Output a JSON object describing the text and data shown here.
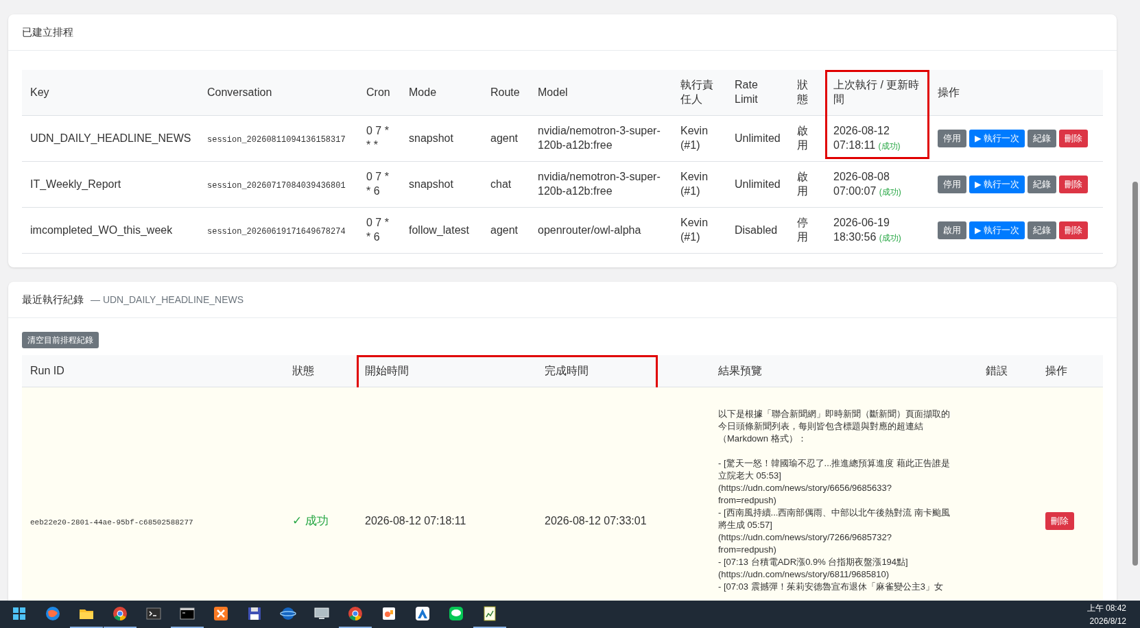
{
  "schedules": {
    "title": "已建立排程",
    "columns": [
      {
        "label": "Key",
        "highlighted": false
      },
      {
        "label": "Conversation",
        "highlighted": false
      },
      {
        "label": "Cron",
        "highlighted": false
      },
      {
        "label": "Mode",
        "highlighted": false
      },
      {
        "label": "Route",
        "highlighted": false
      },
      {
        "label": "Model",
        "highlighted": false
      },
      {
        "label": "執行責任人",
        "highlighted": false
      },
      {
        "label": "Rate Limit",
        "highlighted": false
      },
      {
        "label": "狀態",
        "highlighted": false
      },
      {
        "label": "上次執行 / 更新時間",
        "highlighted": true
      },
      {
        "label": "操作",
        "highlighted": false
      }
    ],
    "rows": [
      {
        "key": "UDN_DAILY_HEADLINE_NEWS",
        "conversation": "session_20260811094136158317",
        "cron": "0 7 * * *",
        "mode": "snapshot",
        "route": "agent",
        "model": "nvidia/nemotron-3-super-120b-a12b:free",
        "owner": "Kevin (#1)",
        "rate_limit": "Unlimited",
        "status": "啟用",
        "last_run_time": "2026-08-12 07:18:11",
        "last_run_result": {
          "label": "(成功)",
          "kind": "success"
        },
        "actions": [
          {
            "label": "停用",
            "kind": "secondary"
          },
          {
            "label": "▶ 執行一次",
            "kind": "primary"
          },
          {
            "label": "紀錄",
            "kind": "secondary"
          },
          {
            "label": "刪除",
            "kind": "danger"
          }
        ]
      },
      {
        "key": "IT_Weekly_Report",
        "conversation": "session_20260717084039436801",
        "cron": "0 7 * * 6",
        "mode": "snapshot",
        "route": "chat",
        "model": "nvidia/nemotron-3-super-120b-a12b:free",
        "owner": "Kevin (#1)",
        "rate_limit": "Unlimited",
        "status": "啟用",
        "last_run_time": "2026-08-08 07:00:07",
        "last_run_result": {
          "label": "(成功)",
          "kind": "success"
        },
        "actions": [
          {
            "label": "停用",
            "kind": "secondary"
          },
          {
            "label": "▶ 執行一次",
            "kind": "primary"
          },
          {
            "label": "紀錄",
            "kind": "secondary"
          },
          {
            "label": "刪除",
            "kind": "danger"
          }
        ]
      },
      {
        "key": "imcompleted_WO_this_week",
        "conversation": "session_20260619171649678274",
        "cron": "0 7 * * 6",
        "mode": "follow_latest",
        "route": "agent",
        "model": "openrouter/owl-alpha",
        "owner": "Kevin (#1)",
        "rate_limit": "Disabled",
        "status": "停用",
        "last_run_time": "2026-06-19 18:30:56",
        "last_run_result": {
          "label": "(成功)",
          "kind": "success"
        },
        "actions": [
          {
            "label": "啟用",
            "kind": "secondary"
          },
          {
            "label": "▶ 執行一次",
            "kind": "primary"
          },
          {
            "label": "紀錄",
            "kind": "secondary"
          },
          {
            "label": "刪除",
            "kind": "danger"
          }
        ]
      }
    ]
  },
  "runs": {
    "title": "最近執行紀錄",
    "subtitle": "— UDN_DAILY_HEADLINE_NEWS",
    "clear_button": "清空目前排程紀錄",
    "columns": [
      {
        "label": "Run ID",
        "highlighted": false
      },
      {
        "label": "狀態",
        "highlighted": false
      },
      {
        "label": "開始時間",
        "highlighted": true
      },
      {
        "label": "完成時間",
        "highlighted": true
      },
      {
        "label": "結果預覽",
        "highlighted": false
      },
      {
        "label": "錯誤",
        "highlighted": false
      },
      {
        "label": "操作",
        "highlighted": false
      }
    ],
    "rows": [
      {
        "run_id": "eeb22e20-2801-44ae-95bf-c68502588277",
        "status": {
          "label": "✓ 成功",
          "kind": "success"
        },
        "started": "2026-08-12 07:18:11",
        "finished": "2026-08-12 07:33:01",
        "preview": [
          [
            "以下是根據「聯合新聞網」即時新聞（斷新聞）頁面擷取的",
            "今日頭條新聞列表，每則皆包含標題與對應的超連結",
            "（Markdown 格式）："
          ],
          [
            "- [驚天一怒！韓國瑜不忍了...推進總預算進度 藉此正告誰是",
            "立院老大 05:53]",
            "(https://udn.com/news/story/6656/9685633?",
            "from=redpush)",
            "- [西南風持續...西南部偶雨、中部以北午後熱對流 南卡颱風",
            "將生成 05:57]",
            "(https://udn.com/news/story/7266/9685732?",
            "from=redpush)",
            "- [07:13 台積電ADR漲0.9% 台指期夜盤漲194點]",
            "(https://udn.com/news/story/6811/9685810)",
            "- [07:03 震撼彈！茱莉安德魯宣布退休「麻雀變公主3」女"
          ]
        ],
        "actions": [
          {
            "label": "刪除",
            "kind": "danger"
          }
        ]
      }
    ]
  },
  "taskbar": {
    "apps": [
      {
        "kind": "start",
        "active": false
      },
      {
        "kind": "globe",
        "active": false
      },
      {
        "kind": "folder",
        "active": true
      },
      {
        "kind": "chrome",
        "active": true
      },
      {
        "kind": "terminal",
        "active": false
      },
      {
        "kind": "console",
        "active": true
      },
      {
        "kind": "xampp",
        "active": false
      },
      {
        "kind": "disk",
        "active": false
      },
      {
        "kind": "planet",
        "active": false
      },
      {
        "kind": "screen",
        "active": false
      },
      {
        "kind": "chrome",
        "active": true
      },
      {
        "kind": "tool",
        "active": false
      },
      {
        "kind": "arrow",
        "active": false
      },
      {
        "kind": "chat",
        "active": false
      },
      {
        "kind": "notepad",
        "active": true
      }
    ],
    "time": "上午 08:42",
    "date": "2026/8/12"
  }
}
